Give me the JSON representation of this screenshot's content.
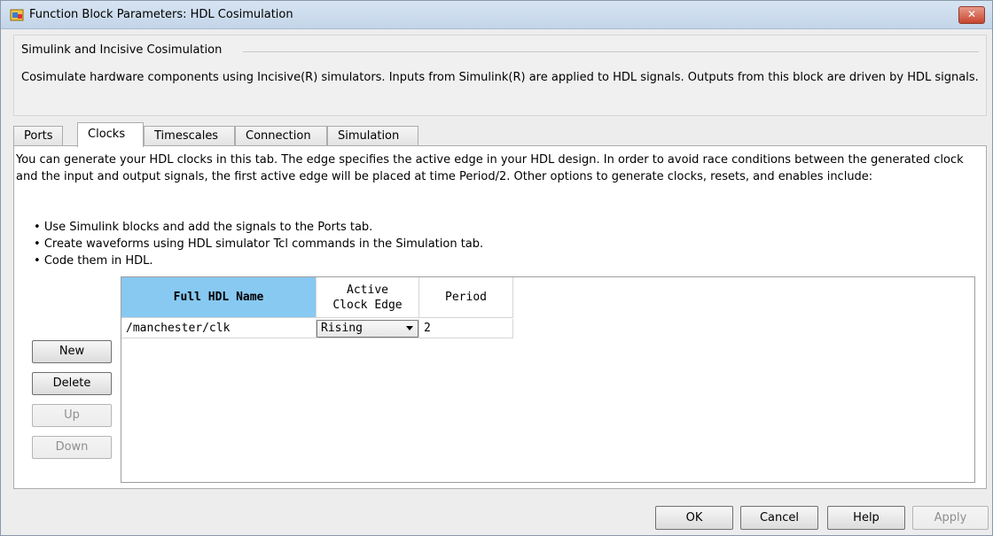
{
  "window": {
    "title": "Function Block Parameters: HDL Cosimulation",
    "close_label": "✕"
  },
  "group": {
    "title": "Simulink and Incisive Cosimulation",
    "description": "Cosimulate hardware components using Incisive(R) simulators.  Inputs from Simulink(R) are applied to HDL signals.  Outputs from this block are driven by HDL signals."
  },
  "tabs": [
    {
      "label": "Ports",
      "active": false
    },
    {
      "label": "Clocks",
      "active": true
    },
    {
      "label": "Timescales",
      "active": false
    },
    {
      "label": "Connection",
      "active": false
    },
    {
      "label": "Simulation",
      "active": false
    }
  ],
  "clocks": {
    "description": "You can generate your HDL clocks in this tab. The edge specifies the active edge in your HDL design. In order to avoid race conditions between the generated clock and the input and output signals, the first active edge will be placed at time Period/2. Other options to generate clocks, resets, and enables include:",
    "bullets": [
      "Use Simulink blocks and add the signals to the Ports tab.",
      "Create waveforms using HDL simulator Tcl commands in the Simulation tab.",
      "Code them in HDL."
    ],
    "buttons": {
      "new": "New",
      "delete": "Delete",
      "up": "Up",
      "down": "Down"
    },
    "table": {
      "columns": [
        "Full HDL Name",
        "Active\nClock Edge",
        "Period"
      ],
      "rows": [
        {
          "name": "/manchester/clk",
          "edge": "Rising",
          "period": "2"
        }
      ]
    }
  },
  "footer": {
    "ok": "OK",
    "cancel": "Cancel",
    "help": "Help",
    "apply": "Apply"
  },
  "colors": {
    "selected_header": "#87c9f1",
    "close_button": "#c7442f"
  },
  "icons": {
    "app": "simulink-block-icon",
    "close": "close-icon",
    "dropdown": "chevron-down-icon"
  }
}
